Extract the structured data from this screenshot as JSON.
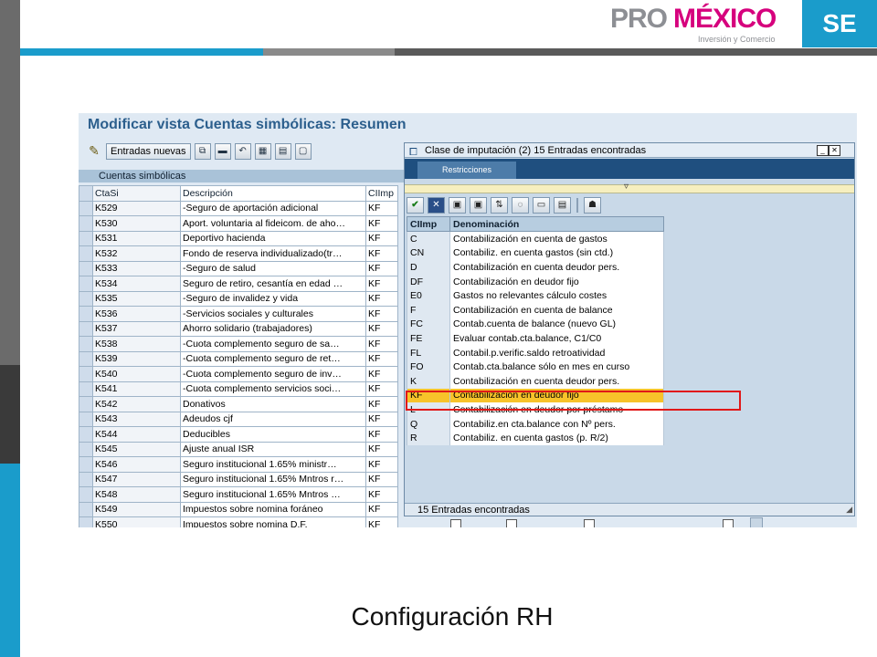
{
  "colors": {
    "brand_blue": "#1a9ccb",
    "brand_magenta": "#d6007d",
    "highlight": "#f7c32a",
    "annotation_red": "#e11818"
  },
  "branding": {
    "logo_pro": "PRO",
    "logo_mexico": "MÉXICO",
    "logo_sub": "Inversión y Comercio",
    "se_label": "SE"
  },
  "sap": {
    "title": "Modificar vista Cuentas simbólicas: Resumen",
    "toolbar": {
      "new_entries_label": "Entradas nuevas",
      "icons": [
        "edit-icon",
        "copy-icon",
        "delete-icon",
        "undo-icon",
        "select-all-icon",
        "select-block-icon",
        "deselect-icon"
      ]
    },
    "grid_title": "Cuentas simbólicas",
    "columns": [
      "CtaSi",
      "Descripción",
      "CIImp"
    ],
    "rows": [
      {
        "cta": "K529",
        "desc": "-Seguro de aportación adicional",
        "cl": "KF"
      },
      {
        "cta": "K530",
        "desc": "Aport. voluntaria al fideicom. de aho…",
        "cl": "KF"
      },
      {
        "cta": "K531",
        "desc": "Deportivo hacienda",
        "cl": "KF"
      },
      {
        "cta": "K532",
        "desc": "Fondo de reserva individualizado(tr…",
        "cl": "KF"
      },
      {
        "cta": "K533",
        "desc": "-Seguro de salud",
        "cl": "KF"
      },
      {
        "cta": "K534",
        "desc": "Seguro de retiro, cesantía en edad …",
        "cl": "KF"
      },
      {
        "cta": "K535",
        "desc": "-Seguro de invalidez y vida",
        "cl": "KF"
      },
      {
        "cta": "K536",
        "desc": "-Servicios sociales y culturales",
        "cl": "KF"
      },
      {
        "cta": "K537",
        "desc": "Ahorro solidario (trabajadores)",
        "cl": "KF"
      },
      {
        "cta": "K538",
        "desc": "-Cuota complemento seguro de sa…",
        "cl": "KF"
      },
      {
        "cta": "K539",
        "desc": "-Cuota complemento seguro de ret…",
        "cl": "KF"
      },
      {
        "cta": "K540",
        "desc": "-Cuota complemento seguro de inv…",
        "cl": "KF"
      },
      {
        "cta": "K541",
        "desc": "-Cuota complemento servicios soci…",
        "cl": "KF"
      },
      {
        "cta": "K542",
        "desc": "Donativos",
        "cl": "KF"
      },
      {
        "cta": "K543",
        "desc": "Adeudos cjf",
        "cl": "KF"
      },
      {
        "cta": "K544",
        "desc": "Deducibles",
        "cl": "KF"
      },
      {
        "cta": "K545",
        "desc": "Ajuste anual ISR",
        "cl": "KF"
      },
      {
        "cta": "K546",
        "desc": "Seguro institucional 1.65% ministr…",
        "cl": "KF"
      },
      {
        "cta": "K547",
        "desc": "Seguro institucional 1.65% Mntros r…",
        "cl": "KF"
      },
      {
        "cta": "K548",
        "desc": "Seguro institucional 1.65% Mntros …",
        "cl": "KF"
      },
      {
        "cta": "K549",
        "desc": "Impuestos sobre nomina foráneo",
        "cl": "KF"
      },
      {
        "cta": "K550",
        "desc": "Impuestos sobre nomina D.F.",
        "cl": "KF"
      }
    ]
  },
  "popup": {
    "title": "Clase de imputación (2)   15 Entradas encontradas",
    "tab": "Restricciones",
    "columns": [
      "CIImp",
      "Denominación"
    ],
    "rows": [
      {
        "k": "C",
        "d": "Contabilización en cuenta de gastos"
      },
      {
        "k": "CN",
        "d": "Contabiliz. en cuenta gastos (sin ctd.)"
      },
      {
        "k": "D",
        "d": "Contabilización en cuenta deudor pers."
      },
      {
        "k": "DF",
        "d": "Contabilización en deudor fijo"
      },
      {
        "k": "E0",
        "d": "Gastos no relevantes cálculo costes"
      },
      {
        "k": "F",
        "d": "Contabilización en cuenta de balance"
      },
      {
        "k": "FC",
        "d": "Contab.cuenta de balance (nuevo GL)"
      },
      {
        "k": "FE",
        "d": "Evaluar contab.cta.balance, C1/C0"
      },
      {
        "k": "FL",
        "d": "Contabil.p.verific.saldo retroatividad"
      },
      {
        "k": "FO",
        "d": "Contab.cta.balance sólo en mes en curso"
      },
      {
        "k": "K",
        "d": "Contabilización en cuenta deudor pers."
      },
      {
        "k": "KF",
        "d": "Contabilización en deudor fijo",
        "highlight": true
      },
      {
        "k": "L",
        "d": "Contabilización en deudor por préstamo"
      },
      {
        "k": "Q",
        "d": "Contabiliz.en cta.balance con Nº pers."
      },
      {
        "k": "R",
        "d": "Contabiliz. en cuenta gastos (p. R/2)"
      }
    ],
    "footer": "15 Entradas encontradas"
  },
  "caption": "Configuración RH"
}
